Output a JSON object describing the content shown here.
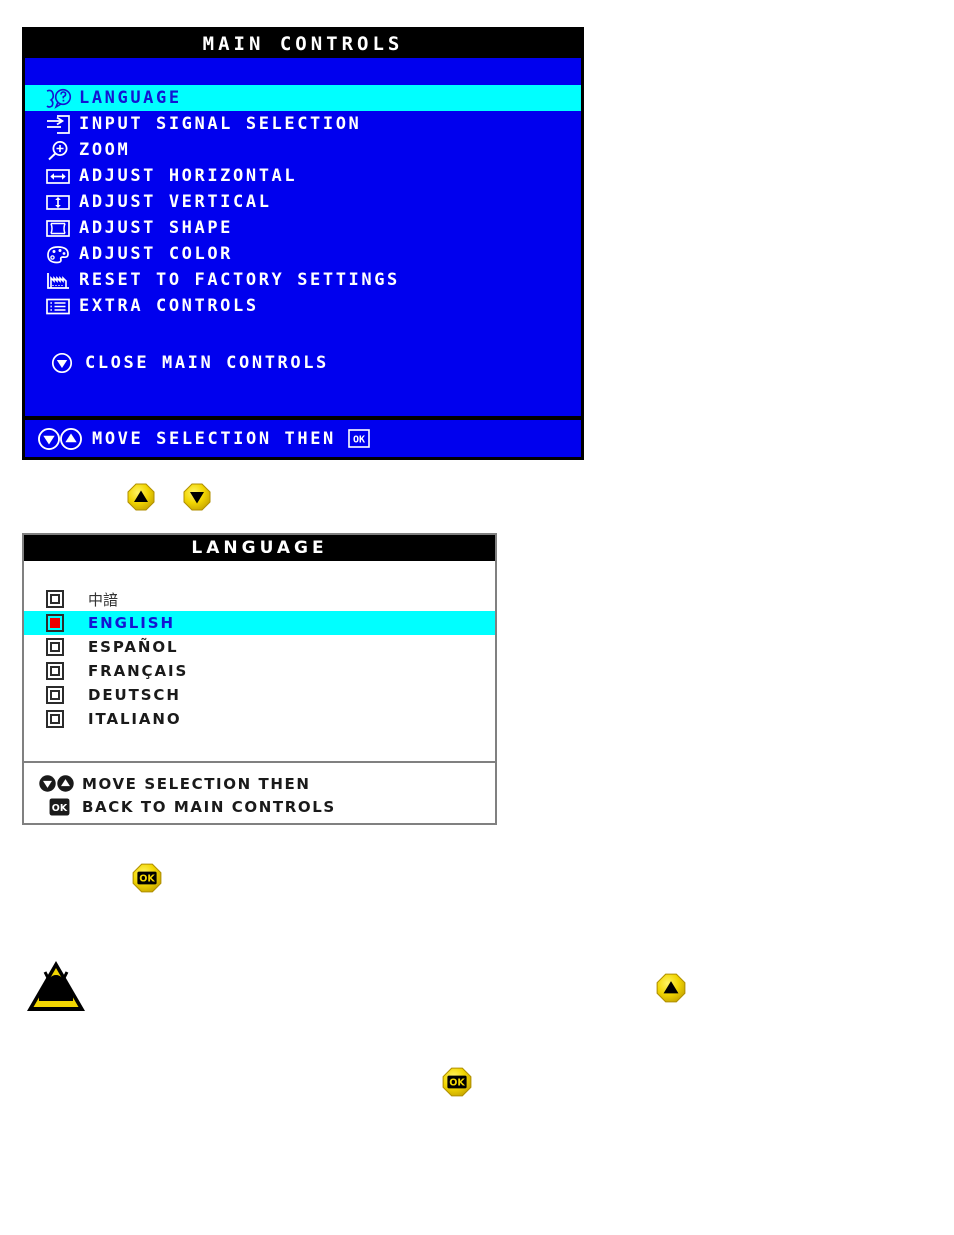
{
  "main_controls": {
    "title": "MAIN CONTROLS",
    "items": [
      {
        "label": "LANGUAGE",
        "icon": "language-person-question-icon",
        "selected": true
      },
      {
        "label": "INPUT SIGNAL SELECTION",
        "icon": "input-signal-arrow-icon",
        "selected": false
      },
      {
        "label": "ZOOM",
        "icon": "magnifier-plus-icon",
        "selected": false
      },
      {
        "label": "ADJUST HORIZONTAL",
        "icon": "horizontal-arrows-icon",
        "selected": false
      },
      {
        "label": "ADJUST VERTICAL",
        "icon": "vertical-arrows-icon",
        "selected": false
      },
      {
        "label": "ADJUST SHAPE",
        "icon": "shape-frame-icon",
        "selected": false
      },
      {
        "label": "ADJUST COLOR",
        "icon": "color-palette-icon",
        "selected": false
      },
      {
        "label": "RESET TO FACTORY SETTINGS",
        "icon": "factory-icon",
        "selected": false
      },
      {
        "label": "EXTRA CONTROLS",
        "icon": "list-lines-icon",
        "selected": false
      }
    ],
    "close_item": {
      "label": "CLOSE MAIN CONTROLS",
      "icon": "down-arrow-circle-icon"
    },
    "footer": {
      "text": "MOVE SELECTION THEN",
      "icons": [
        "down-arrow-circle-icon",
        "up-arrow-circle-icon"
      ],
      "trailing_icon": "ok-box-icon"
    },
    "colors": {
      "background": "#0000ee",
      "title_bar": "#000000",
      "highlight": "#00ffff",
      "text": "#ffffff",
      "highlight_text": "#1414d2"
    }
  },
  "nav_buttons": [
    {
      "name": "up-arrow-button",
      "icon": "up-arrow-icon"
    },
    {
      "name": "down-arrow-button",
      "icon": "down-arrow-icon"
    }
  ],
  "language_menu": {
    "title": "LANGUAGE",
    "items": [
      {
        "label": "中諳",
        "icon": "radio-unselected-icon",
        "selected": false,
        "cjk": true
      },
      {
        "label": "ENGLISH",
        "icon": "radio-selected-icon",
        "selected": true,
        "cjk": false
      },
      {
        "label": "ESPAÑOL",
        "icon": "radio-unselected-icon",
        "selected": false,
        "cjk": false
      },
      {
        "label": "FRANÇAIS",
        "icon": "radio-unselected-icon",
        "selected": false,
        "cjk": false
      },
      {
        "label": "DEUTSCH",
        "icon": "radio-unselected-icon",
        "selected": false,
        "cjk": false
      },
      {
        "label": "ITALIANO",
        "icon": "radio-unselected-icon",
        "selected": false,
        "cjk": false
      }
    ],
    "footer_lines": [
      {
        "text": "MOVE SELECTION THEN",
        "icons": [
          "down-arrow-circle-icon",
          "up-arrow-circle-icon"
        ]
      },
      {
        "text": "BACK TO MAIN CONTROLS",
        "icons": [
          "ok-box-icon"
        ]
      }
    ],
    "colors": {
      "background": "#ffffff",
      "title_bar": "#000000",
      "highlight": "#00ffff",
      "text": "#1a1a1a",
      "highlight_text": "#1414d2",
      "radio_selected": "#ee0000"
    }
  },
  "standalone_buttons": [
    {
      "name": "ok-button-below-language-menu",
      "icon": "ok-button-icon"
    },
    {
      "name": "warning-triangle",
      "icon": "warning-triangle-icon"
    },
    {
      "name": "up-arrow-button-right",
      "icon": "up-arrow-icon"
    },
    {
      "name": "ok-button-bottom",
      "icon": "ok-button-icon"
    }
  ],
  "button_colors": {
    "yellow": "#f2d602",
    "yellow_dark": "#b79c00",
    "glyph": "#000000"
  }
}
